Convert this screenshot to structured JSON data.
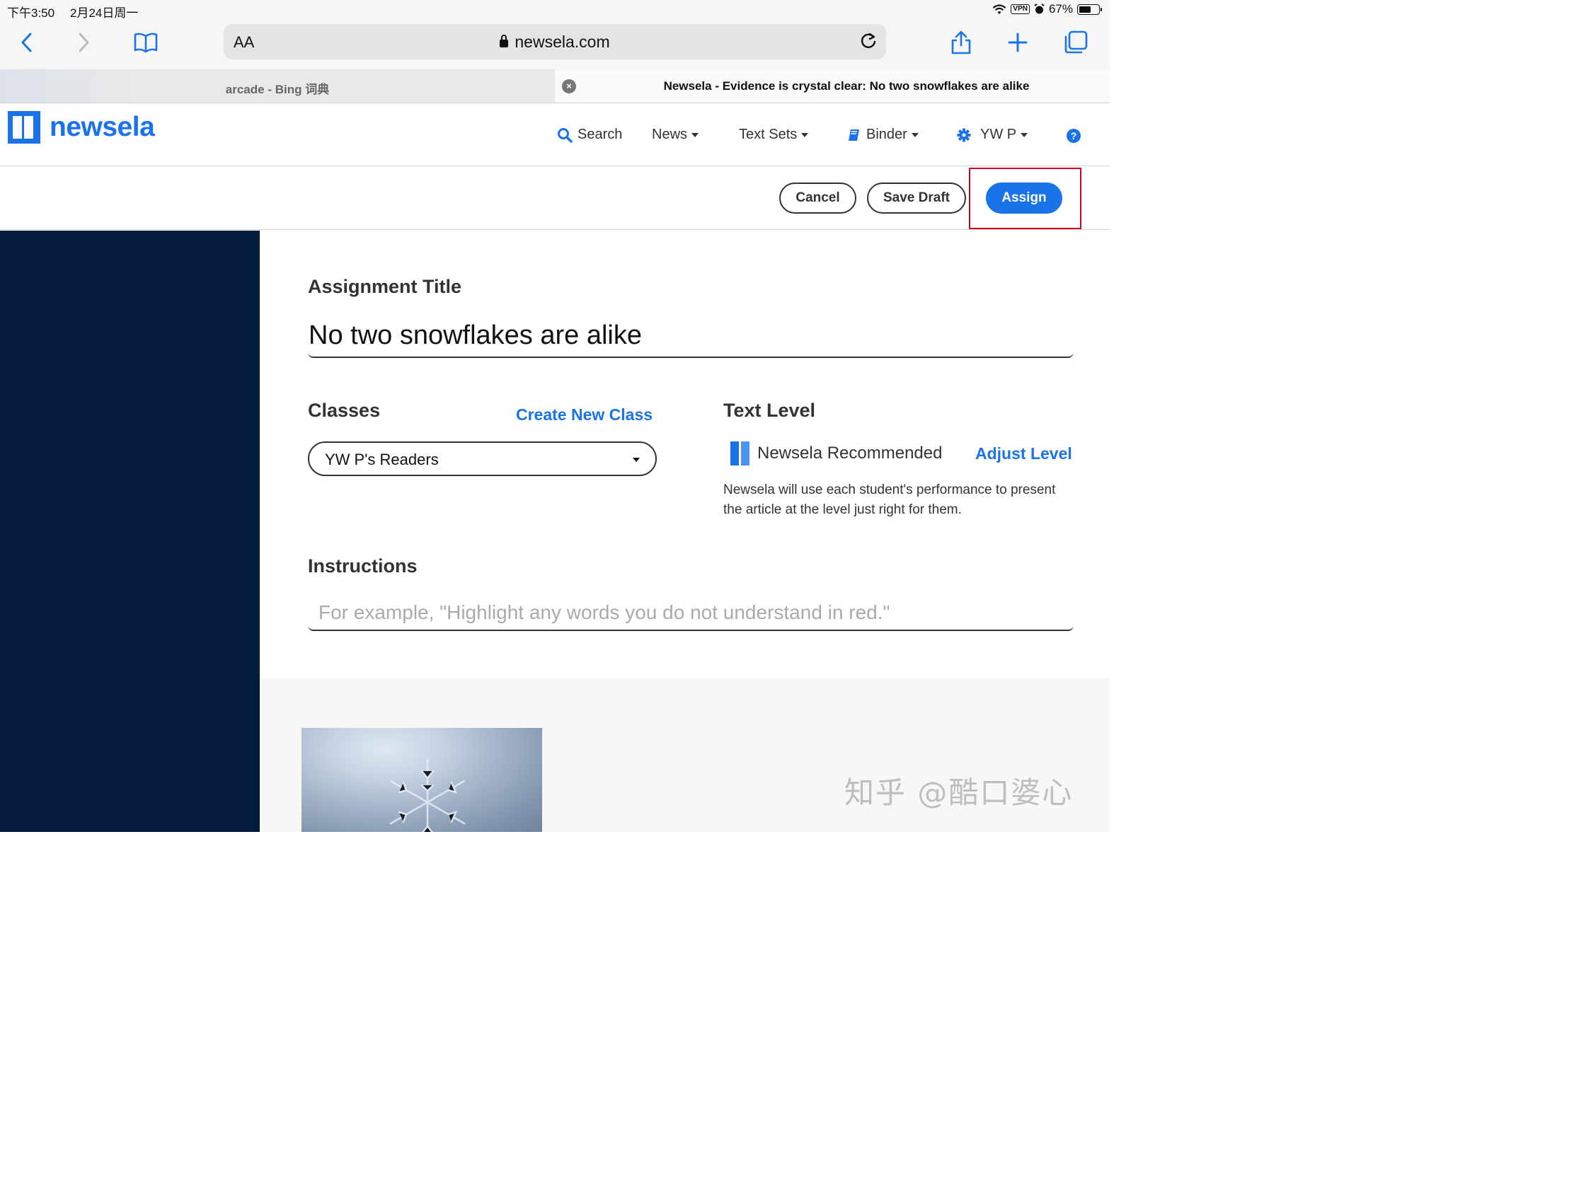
{
  "status_bar": {
    "time": "下午3:50",
    "date": "2月24日周一",
    "vpn": "VPN",
    "battery": "67%",
    "battery_fraction": 0.67
  },
  "browser": {
    "aa_label": "AA",
    "url": "newsela.com",
    "icons": [
      "back-icon",
      "forward-icon",
      "bookmarks-icon",
      "lock-icon",
      "reload-icon",
      "share-icon",
      "new-tab-icon",
      "tabs-icon"
    ],
    "tabs": [
      {
        "title": "arcade - Bing 词典"
      },
      {
        "title": "Newsela - Evidence is crystal clear: No two snowflakes are alike"
      }
    ]
  },
  "site": {
    "logo_text": "newsela",
    "nav": {
      "search": "Search",
      "news": "News",
      "text_sets": "Text Sets",
      "binder": "Binder",
      "user": "YW P"
    },
    "brand_color": "#1a73e8"
  },
  "actions": {
    "cancel": "Cancel",
    "save_draft": "Save Draft",
    "assign": "Assign",
    "highlight_color": "#d0021b"
  },
  "form": {
    "assignment_title_label": "Assignment Title",
    "assignment_title_value": "No two snowflakes are alike",
    "classes_label": "Classes",
    "create_new_class": "Create New Class",
    "class_selected": "YW P's Readers",
    "text_level_label": "Text Level",
    "text_level_value": "Newsela Recommended",
    "adjust_level": "Adjust Level",
    "text_level_description": "Newsela will use each student's performance to present the article at the level just right for them.",
    "instructions_label": "Instructions",
    "instructions_placeholder": "For example, \"Highlight any words you do not understand in red.\""
  },
  "watermark": "知乎 @酷口婆心"
}
